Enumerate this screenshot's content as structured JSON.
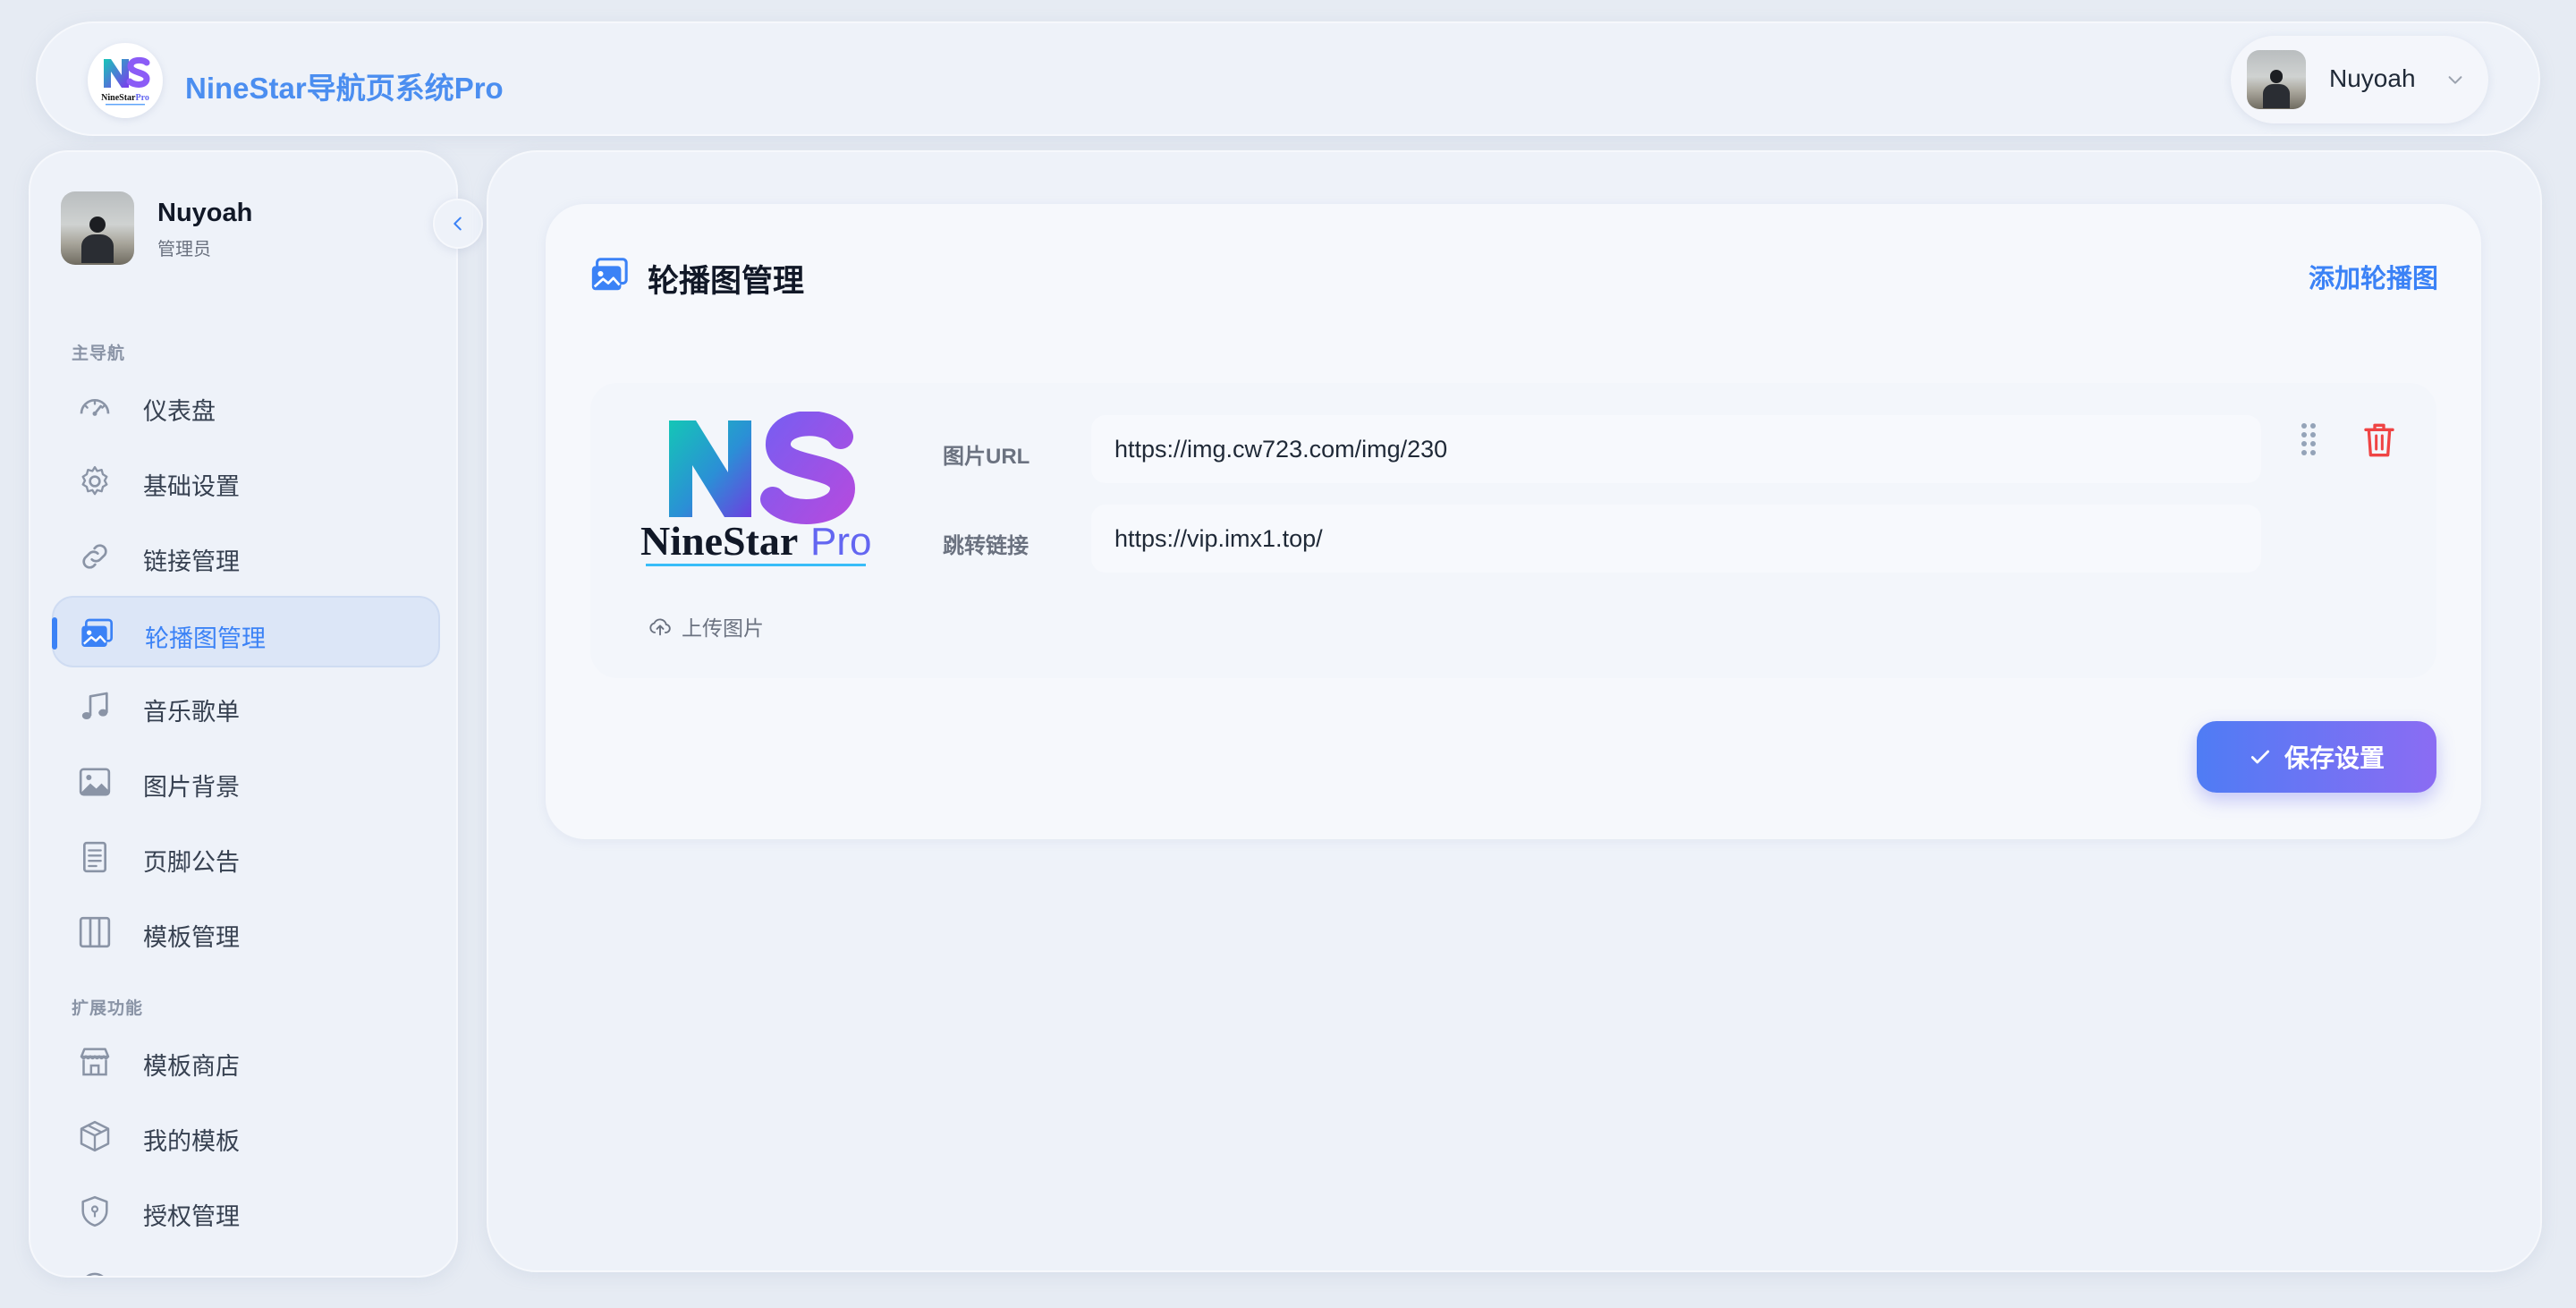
{
  "header": {
    "brand_title": "NineStar导航页系统Pro",
    "logo_alt": "NineStarPro",
    "user_name": "Nuyoah"
  },
  "sidebar": {
    "user_name": "Nuyoah",
    "user_role": "管理员",
    "sections": {
      "main": "主导航",
      "extended": "扩展功能"
    },
    "items": [
      {
        "label": "仪表盘",
        "icon": "dashboard-icon"
      },
      {
        "label": "基础设置",
        "icon": "gear-icon"
      },
      {
        "label": "链接管理",
        "icon": "link-icon"
      },
      {
        "label": "轮播图管理",
        "icon": "image-gallery-icon",
        "active": true
      },
      {
        "label": "音乐歌单",
        "icon": "music-note-icon"
      },
      {
        "label": "图片背景",
        "icon": "picture-icon"
      },
      {
        "label": "页脚公告",
        "icon": "document-icon"
      },
      {
        "label": "模板管理",
        "icon": "columns-icon"
      }
    ],
    "extended_items": [
      {
        "label": "模板商店",
        "icon": "store-icon"
      },
      {
        "label": "我的模板",
        "icon": "box-icon"
      },
      {
        "label": "授权管理",
        "icon": "shield-icon"
      }
    ]
  },
  "main": {
    "title": "轮播图管理",
    "add_label": "添加轮播图",
    "slide": {
      "logo_text_main": "NineStar",
      "logo_text_accent": "Pro",
      "upload_label": "上传图片",
      "url_label": "图片URL",
      "url_value": "https://img.cw723.com/img/230",
      "link_label": "跳转链接",
      "link_value": "https://vip.imx1.top/"
    },
    "save_label": "保存设置"
  },
  "colors": {
    "accent": "#3b82f6",
    "brand_title": "#4b8ef0",
    "delete": "#ef4444",
    "save_gradient_start": "#4f7cf4",
    "save_gradient_end": "#8b6cf3"
  }
}
